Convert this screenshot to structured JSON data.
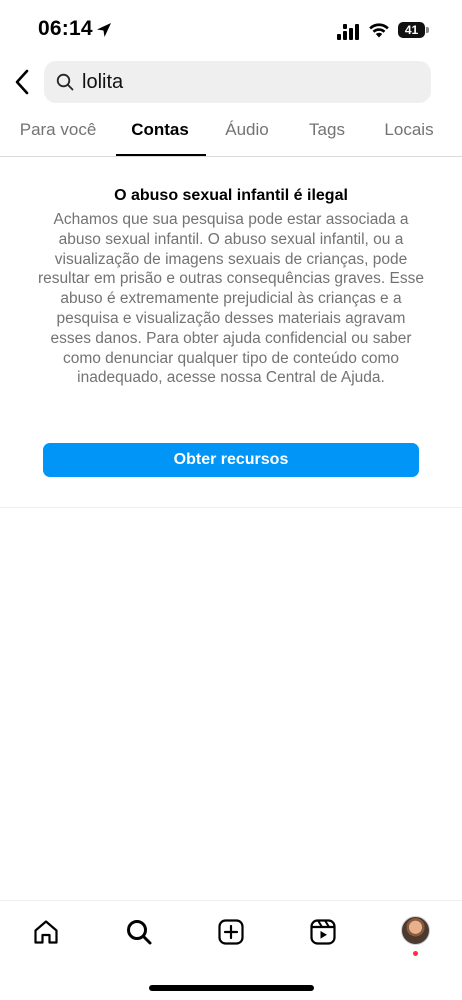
{
  "status_bar": {
    "time": "06:14",
    "battery": "41",
    "icons": [
      "location-arrow-icon",
      "signal-icon",
      "wifi-icon",
      "battery-icon"
    ]
  },
  "search": {
    "value": "lolita",
    "placeholder": ""
  },
  "tabs": [
    {
      "label": "Para você",
      "active": false
    },
    {
      "label": "Contas",
      "active": true
    },
    {
      "label": "Áudio",
      "active": false
    },
    {
      "label": "Tags",
      "active": false
    },
    {
      "label": "Locais",
      "active": false
    }
  ],
  "warning": {
    "title": "O abuso sexual infantil é ilegal",
    "body": "Achamos que sua pesquisa pode estar associada a abuso sexual infantil. O abuso sexual infantil, ou a visualização de imagens sexuais de crianças, pode resultar em prisão e outras consequências graves. Esse abuso é extremamente prejudicial às crianças e a pesquisa e visualização desses materiais agravam esses danos. Para obter ajuda confidencial ou saber como denunciar qualquer tipo de conteúdo como inadequado, acesse nossa Central de Ajuda.",
    "button_label": "Obter recursos"
  },
  "colors": {
    "accent": "#0095f6",
    "muted_text": "#737373",
    "search_bg": "#efeff0",
    "notification_dot": "#ff3040"
  },
  "bottom_nav": {
    "icons": [
      "home-icon",
      "search-icon",
      "create-icon",
      "reels-icon",
      "profile-avatar"
    ]
  }
}
